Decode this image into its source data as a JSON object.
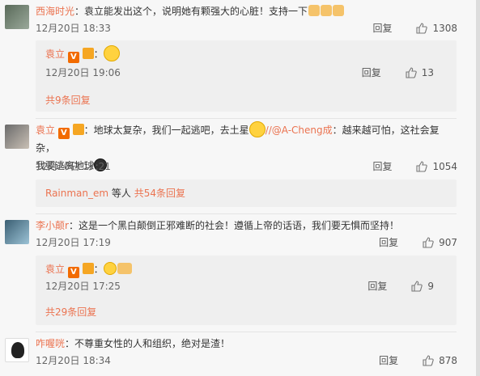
{
  "comments": [
    {
      "user": "西海时光",
      "text": "：袁立能发出这个，说明她有颗强大的心脏！支持一下",
      "date": "12月20日 18:33",
      "reply": "回复",
      "likes": "1308",
      "sub": {
        "user": "袁立",
        "text": "：",
        "date": "12月20日 19:06",
        "reply": "回复",
        "likes": "13",
        "more": "共9条回复"
      }
    },
    {
      "user": "袁立",
      "text": "：地球太复杂，我们一起逃吧，去土星",
      "mention": "//@A-Cheng成",
      "text2": "：越来越可怕，这社会复杂，",
      "text3": "我要逃离地球",
      "date": "12月20日 17:21",
      "reply": "回复",
      "likes": "1054",
      "sub_more_user": "Rainman_em",
      "sub_more_mid": " 等人 ",
      "sub_more": "共54条回复"
    },
    {
      "user": "李小颠r",
      "text": "：这是一个黑白颠倒正邪难断的社会！遵循上帝的话语，我们要无惧而坚持！",
      "date": "12月20日 17:19",
      "reply": "回复",
      "likes": "907",
      "sub": {
        "user": "袁立",
        "text": "：",
        "date": "12月20日 17:25",
        "reply": "回复",
        "likes": "9",
        "more": "共29条回复"
      }
    },
    {
      "user": "咋喔咣",
      "text": "：不尊重女性的人和组织，绝对是渣！",
      "date": "12月20日 18:34",
      "reply": "回复",
      "likes": "878"
    }
  ],
  "icons": {
    "like": "thumbs-up-icon",
    "verified": "verified-v-icon",
    "member": "member-crown-icon"
  },
  "colors": {
    "username": "#eb7350",
    "panel": "#efefef",
    "background": "#f7f7f7"
  }
}
